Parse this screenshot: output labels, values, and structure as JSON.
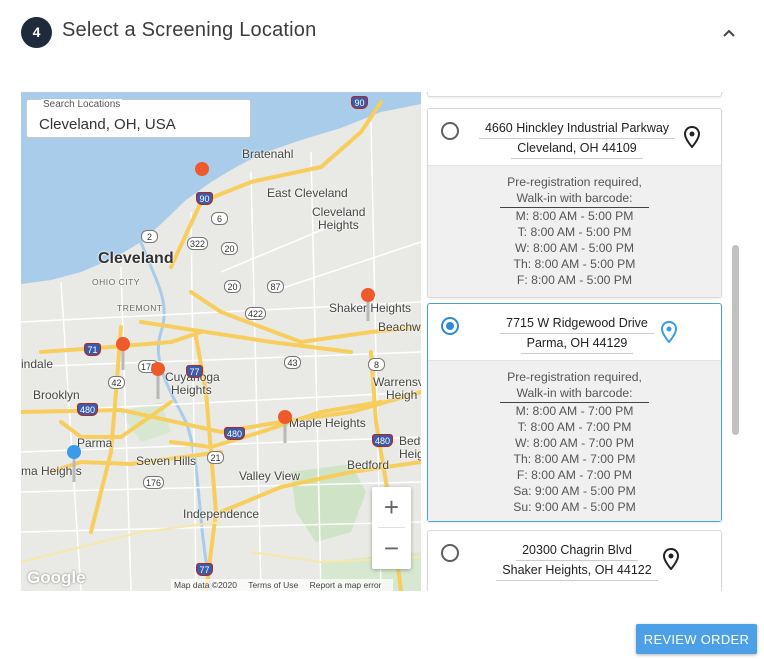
{
  "header": {
    "step_number": "4",
    "title": "Select a Screening Location",
    "collapse_icon": "chevron-up-icon"
  },
  "map": {
    "search": {
      "label": "Search Locations",
      "value": "Cleveland, OH, USA"
    },
    "labels": {
      "bratenahl": "Bratenahl",
      "east_cleveland": "East Cleveland",
      "cleveland_heights_1": "Cleveland",
      "cleveland_heights_2": "Heights",
      "cleveland": "Cleveland",
      "ohio_city": "OHIO CITY",
      "tremont": "TREMONT",
      "shaker_heights": "Shaker Heights",
      "beachwood": "Beachwo",
      "cuyahoga_heights_1": "Cuyahoga",
      "cuyahoga_heights_2": "Heights",
      "brooklyn": "Brooklyn",
      "lindale": "indale",
      "warrensville_1": "Warrensv",
      "warrensville_2": "Heigh",
      "maple_heights": "Maple Heights",
      "parma": "Parma",
      "parma_heights": "ma Heights",
      "seven_hills": "Seven Hills",
      "valley_view": "Valley View",
      "bedford": "Bedford",
      "bedford_heights_1": "Bedf",
      "bedford_heights_2": "Heigh",
      "independence": "Independence"
    },
    "shields": [
      "90",
      "90",
      "6",
      "2",
      "322",
      "20",
      "20",
      "87",
      "422",
      "71",
      "176",
      "77",
      "42",
      "43",
      "480",
      "480",
      "480",
      "21",
      "176",
      "77",
      "8"
    ],
    "zoom_in": "+",
    "zoom_out": "−",
    "logo": "Google",
    "attribution": {
      "map_data": "Map data ©2020",
      "terms": "Terms of Use",
      "report": "Report a map error"
    },
    "colors": {
      "water": "#a8cce9",
      "land": "#e9e9e5",
      "highway": "#f7cd5d",
      "marker_red": "#ee5a2c",
      "marker_blue": "#3a9be8"
    }
  },
  "locations": [
    {
      "address_line1": "4660 Hinckley Industrial Parkway",
      "address_line2": "Cleveland, OH 44109",
      "selected": false,
      "note_line1": "Pre-registration required,",
      "note_line2": "Walk-in with barcode:",
      "hours": [
        "M: 8:00 AM - 5:00 PM",
        "T: 8:00 AM - 5:00 PM",
        "W: 8:00 AM - 5:00 PM",
        "Th: 8:00 AM - 5:00 PM",
        "F: 8:00 AM - 5:00 PM"
      ],
      "pin_icon": "map-pin-icon"
    },
    {
      "address_line1": "7715 W Ridgewood Drive",
      "address_line2": "Parma, OH 44129",
      "selected": true,
      "note_line1": "Pre-registration required,",
      "note_line2": "Walk-in with barcode:",
      "hours": [
        "M: 8:00 AM - 7:00 PM",
        "T: 8:00 AM - 7:00 PM",
        "W: 8:00 AM - 7:00 PM",
        "Th: 8:00 AM - 7:00 PM",
        "F: 8:00 AM - 7:00 PM",
        "Sa: 9:00 AM - 5:00 PM",
        "Su: 9:00 AM - 5:00 PM"
      ],
      "pin_icon": "map-pin-icon"
    },
    {
      "address_line1": "20300 Chagrin Blvd",
      "address_line2": "Shaker Heights, OH 44122",
      "selected": false,
      "pin_icon": "map-pin-icon"
    }
  ],
  "footer": {
    "review_button": "REVIEW ORDER"
  }
}
